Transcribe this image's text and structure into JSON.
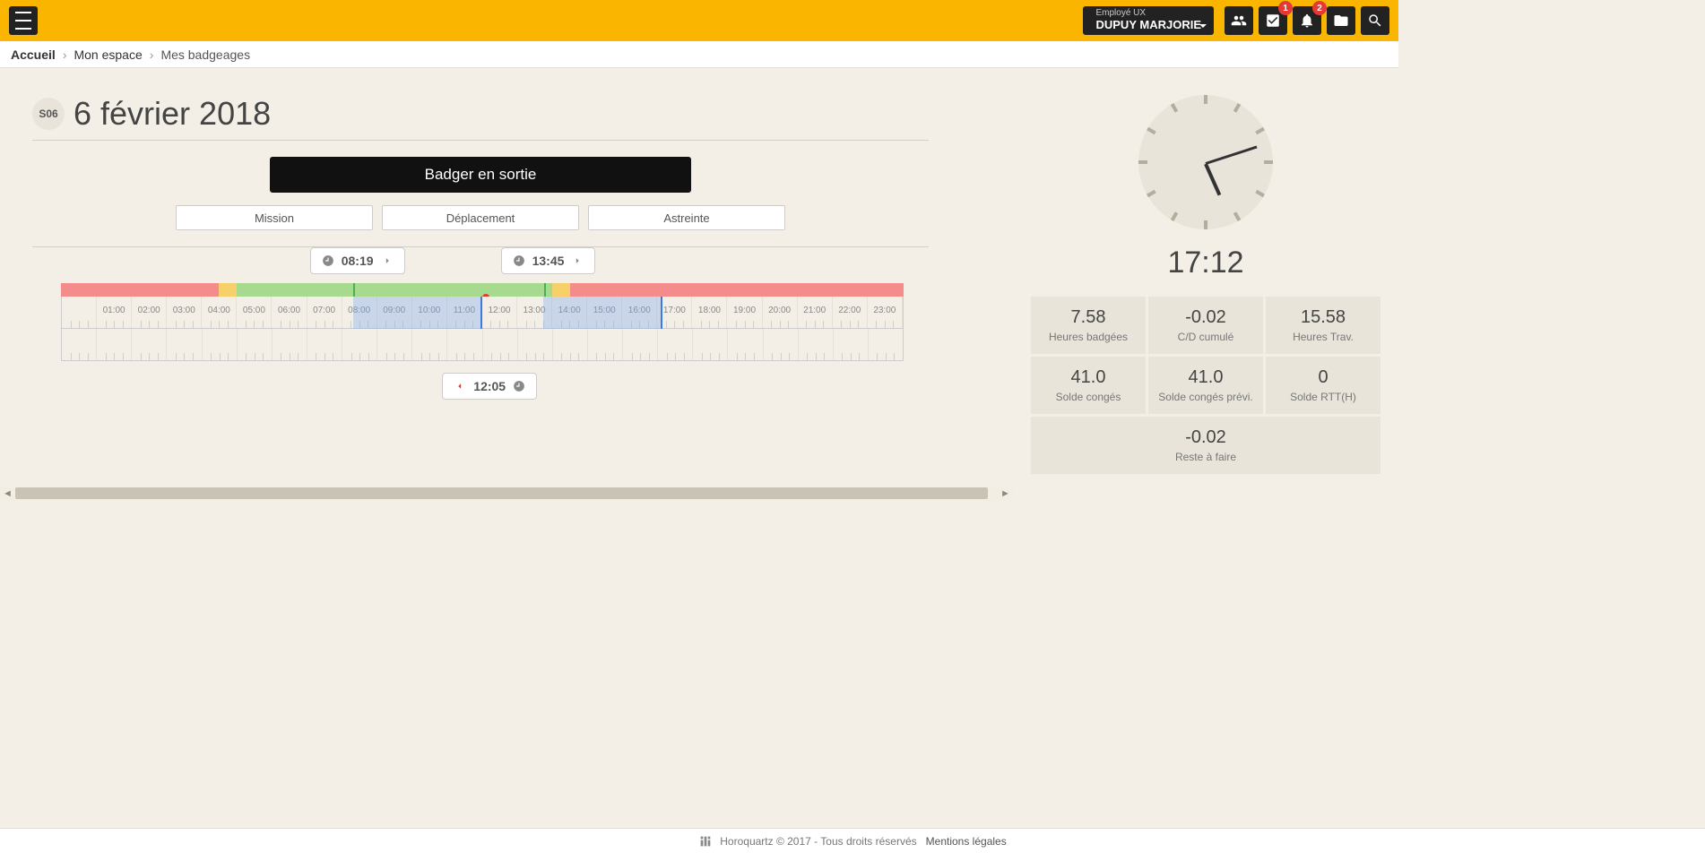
{
  "header": {
    "user_role": "Employé UX",
    "user_name": "DUPUY MARJORIE",
    "badge_notif1": "1",
    "badge_notif2": "2"
  },
  "breadcrumb": {
    "home": "Accueil",
    "level2": "Mon espace",
    "level3": "Mes badgeages"
  },
  "page": {
    "week_chip": "S06",
    "title": "6 février 2018"
  },
  "buttons": {
    "badge_out": "Badger en sortie",
    "mission": "Mission",
    "deplacement": "Déplacement",
    "astreinte": "Astreinte"
  },
  "timeline": {
    "hours": [
      "01:00",
      "02:00",
      "03:00",
      "04:00",
      "05:00",
      "06:00",
      "07:00",
      "08:00",
      "09:00",
      "10:00",
      "11:00",
      "12:00",
      "13:00",
      "14:00",
      "15:00",
      "16:00",
      "17:00",
      "18:00",
      "19:00",
      "20:00",
      "21:00",
      "22:00",
      "23:00"
    ],
    "segments": [
      {
        "color": "c-red",
        "width_pct": 18.75
      },
      {
        "color": "c-yellow",
        "width_pct": 2.08
      },
      {
        "color": "c-green",
        "width_pct": 37.5
      },
      {
        "color": "c-yellow",
        "width_pct": 2.08
      },
      {
        "color": "c-red",
        "width_pct": 39.59
      }
    ],
    "work_blocks": [
      {
        "start_pct": 34.65,
        "width_pct": 15.3
      },
      {
        "start_pct": 57.3,
        "width_pct": 14.16
      }
    ],
    "entries": [
      {
        "time": "08:19",
        "pos_pct": 34.65,
        "kind": "in"
      },
      {
        "time": "13:45",
        "pos_pct": 57.3,
        "kind": "in"
      }
    ],
    "exits": [
      {
        "time": "12:05",
        "pos_pct": 50.35,
        "kind": "out"
      }
    ]
  },
  "side": {
    "digital_time": "17:12",
    "clock": {
      "hour_deg": 516,
      "min_deg": 72
    },
    "stats": [
      {
        "value": "7.58",
        "label": "Heures badgées"
      },
      {
        "value": "-0.02",
        "label": "C/D cumulé"
      },
      {
        "value": "15.58",
        "label": "Heures Trav."
      },
      {
        "value": "41.0",
        "label": "Solde congés"
      },
      {
        "value": "41.0",
        "label": "Solde congés prévi."
      },
      {
        "value": "0",
        "label": "Solde RTT(H)"
      }
    ],
    "stat_full": {
      "value": "-0.02",
      "label": "Reste à faire"
    }
  },
  "footer": {
    "copyright": "Horoquartz © 2017 - Tous droits réservés",
    "legal": "Mentions légales"
  }
}
